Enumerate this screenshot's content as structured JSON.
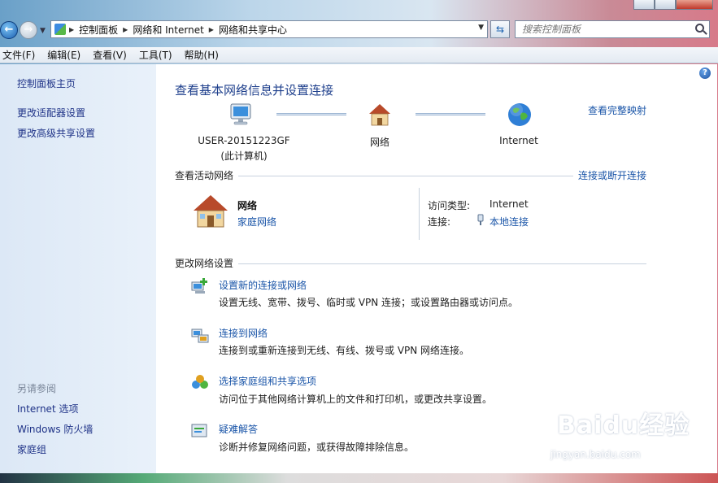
{
  "address": {
    "crumbs": [
      "控制面板",
      "网络和 Internet",
      "网络和共享中心"
    ]
  },
  "search": {
    "placeholder": "搜索控制面板"
  },
  "menu": [
    "文件(F)",
    "编辑(E)",
    "查看(V)",
    "工具(T)",
    "帮助(H)"
  ],
  "sidebar": {
    "items": [
      "控制面板主页",
      "更改适配器设置",
      "更改高级共享设置"
    ],
    "see_also_title": "另请参阅",
    "see_also": [
      "Internet 选项",
      "Windows 防火墙",
      "家庭组"
    ]
  },
  "main": {
    "title": "查看基本网络信息并设置连接",
    "map_link": "查看完整映射",
    "nodes": {
      "computer_line1": "USER-20151223GF",
      "computer_line2": "(此计算机)",
      "network": "网络",
      "internet": "Internet"
    },
    "active": {
      "section_title": "查看活动网络",
      "section_link": "连接或断开连接",
      "network_name": "网络",
      "network_type": "家庭网络",
      "access_label": "访问类型:",
      "access_value": "Internet",
      "connection_label": "连接:",
      "connection_value": "本地连接"
    },
    "settings": {
      "section_title": "更改网络设置",
      "tasks": [
        {
          "icon": "new-connection-icon",
          "title": "设置新的连接或网络",
          "desc": "设置无线、宽带、拨号、临时或 VPN 连接；或设置路由器或访问点。"
        },
        {
          "icon": "connect-network-icon",
          "title": "连接到网络",
          "desc": "连接到或重新连接到无线、有线、拨号或 VPN 网络连接。"
        },
        {
          "icon": "homegroup-icon",
          "title": "选择家庭组和共享选项",
          "desc": "访问位于其他网络计算机上的文件和打印机，或更改共享设置。"
        },
        {
          "icon": "troubleshoot-icon",
          "title": "疑难解答",
          "desc": "诊断并修复网络问题，或获得故障排除信息。"
        }
      ]
    }
  },
  "watermark": {
    "brand": "Baidu经验",
    "url": "jingyan.baidu.com"
  }
}
